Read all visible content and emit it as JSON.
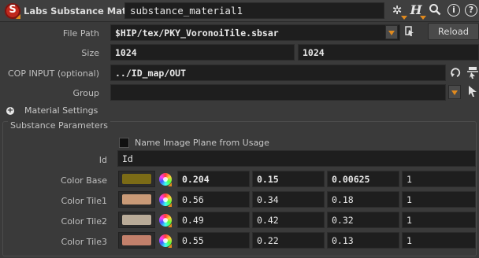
{
  "header": {
    "node_type": "Labs Substance Material",
    "node_name": "substance_material1",
    "icons": [
      "gear-icon",
      "help-h-icon",
      "search-icon",
      "info-icon",
      "help-icon"
    ]
  },
  "params": {
    "file_path": {
      "label": "File Path",
      "value": "$HIP/tex/PKY_VoronoiTile.sbsar",
      "reload_label": "Reload"
    },
    "size": {
      "label": "Size",
      "x": "1024",
      "y": "1024"
    },
    "cop_input": {
      "label": "COP INPUT (optional)",
      "value": "../ID_map/OUT"
    },
    "group": {
      "label": "Group",
      "value": ""
    }
  },
  "material_settings": {
    "label": "Material Settings"
  },
  "substance_params": {
    "title": "Substance Parameters",
    "name_image_plane": {
      "label": "Name Image Plane from Usage",
      "checked": false
    },
    "id": {
      "label": "Id",
      "value": "Id"
    },
    "colors": [
      {
        "label": "Color Base",
        "swatch": "#7b6b16",
        "r": "0.204",
        "g": "0.15",
        "b": "0.00625",
        "a": "1",
        "bold": true
      },
      {
        "label": "Color Tile1",
        "swatch": "#c99a77",
        "r": "0.56",
        "g": "0.34",
        "b": "0.18",
        "a": "1",
        "bold": false
      },
      {
        "label": "Color Tile2",
        "swatch": "#b9ab98",
        "r": "0.49",
        "g": "0.42",
        "b": "0.32",
        "a": "1",
        "bold": false
      },
      {
        "label": "Color Tile3",
        "swatch": "#c3806b",
        "r": "0.55",
        "g": "0.22",
        "b": "0.13",
        "a": "1",
        "bold": false
      }
    ]
  },
  "colors": {
    "background": "#3a3a3a",
    "field": "#1e1e1e",
    "accent": "#e08a1e",
    "node_icon": "#c0281c"
  }
}
